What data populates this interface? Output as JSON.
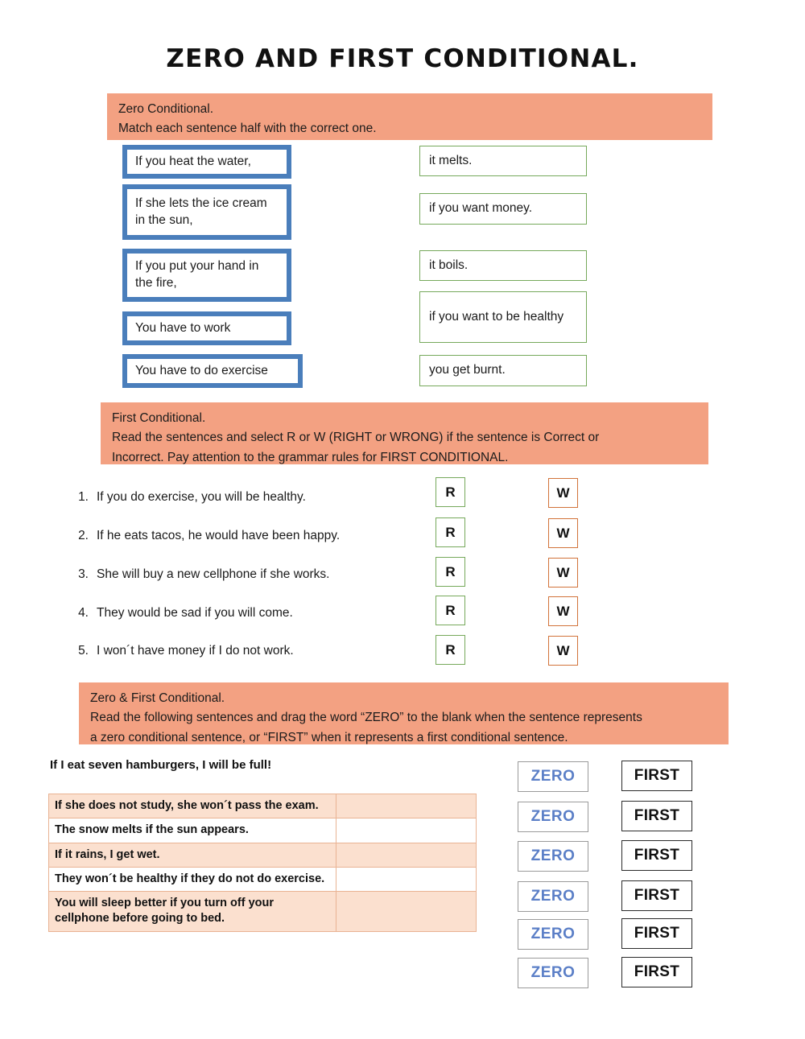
{
  "title": "ZERO AND FIRST CONDITIONAL.",
  "section_zero": {
    "banner_line1": "Zero Conditional.",
    "banner_line2": "Match each sentence half with the correct one.",
    "left_halves": [
      "If you heat the water,",
      "If she lets the ice cream in the sun,",
      "If you put your hand in the fire,",
      "You have to work",
      "You have to do exercise"
    ],
    "right_halves": [
      "it melts.",
      "if you want money.",
      "it boils.",
      "if you want to be healthy",
      "you get burnt."
    ]
  },
  "section_first": {
    "banner_line1": "First Conditional.",
    "banner_line2": "Read the sentences and select R or W (RIGHT or WRONG) if the sentence is Correct or",
    "banner_line3": "Incorrect. Pay attention to the grammar rules for FIRST CONDITIONAL.",
    "right_label": "R",
    "wrong_label": "W",
    "items": [
      {
        "number": "1.",
        "text": "If you do exercise, you will be healthy."
      },
      {
        "number": "2.",
        "text": "If he eats tacos, he would have been happy."
      },
      {
        "number": "3.",
        "text": "She will buy a new cellphone if she works."
      },
      {
        "number": "4.",
        "text": "They would be sad if you will come."
      },
      {
        "number": "5.",
        "text": "I won´t have money if I do not work."
      }
    ]
  },
  "section_both": {
    "banner_line1": "Zero & First Conditional.",
    "banner_line2": "Read the following sentences and drag the word “ZERO” to the blank when the sentence represents",
    "banner_line3": "a zero conditional sentence, or “FIRST” when it represents a first conditional sentence.",
    "example_sentence": "If I eat seven hamburgers, I will be full!",
    "rows": [
      {
        "sentence": "If she does not study, she won´t pass the exam.",
        "answer": ""
      },
      {
        "sentence": "The snow melts if the sun appears.",
        "answer": ""
      },
      {
        "sentence": "If it rains, I get wet.",
        "answer": ""
      },
      {
        "sentence": "They won´t be healthy if they do not do exercise.",
        "answer": ""
      },
      {
        "sentence": "You will sleep better if you turn off your cellphone before going to bed.",
        "answer": ""
      }
    ],
    "zero_chips": [
      "ZERO",
      "ZERO",
      "ZERO",
      "ZERO",
      "ZERO",
      "ZERO"
    ],
    "first_chips": [
      "FIRST",
      "FIRST",
      "FIRST",
      "FIRST",
      "FIRST",
      "FIRST"
    ]
  },
  "colors": {
    "banner": "#F3A182",
    "left_box_border": "#4A7EBB",
    "right_box_border": "#76A95B",
    "wrong_border": "#D2733A",
    "zero_text": "#5B7FC7",
    "table_shade": "#FBE0CF"
  }
}
